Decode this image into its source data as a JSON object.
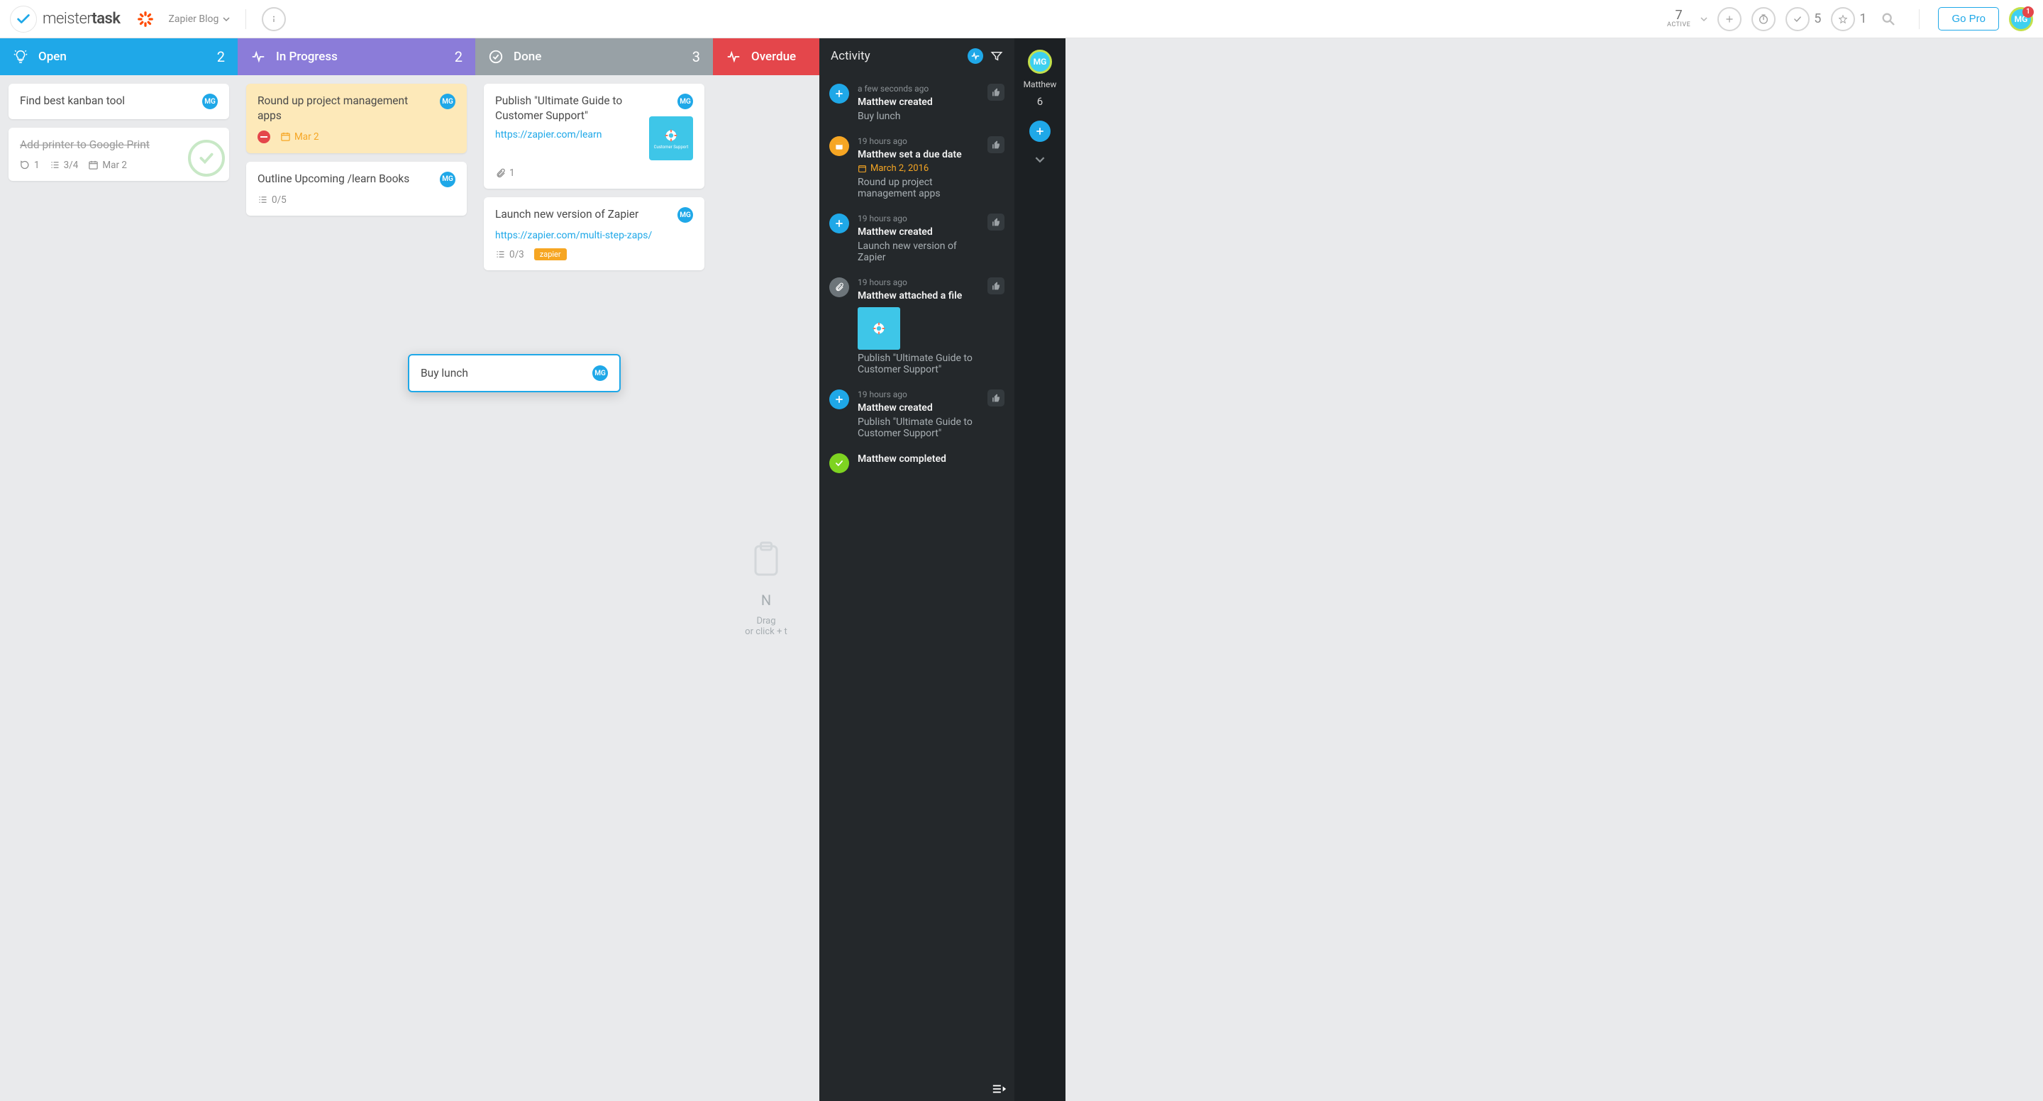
{
  "header": {
    "logo_light": "meister",
    "logo_bold": "task",
    "project_name": "Zapier Blog",
    "active_count": "7",
    "active_label": "ACTIVE",
    "check_count": "5",
    "star_count": "1",
    "go_pro": "Go Pro",
    "avatar_initials": "MG",
    "avatar_badge": "1"
  },
  "columns": {
    "open": {
      "title": "Open",
      "count": "2"
    },
    "progress": {
      "title": "In Progress",
      "count": "2"
    },
    "done": {
      "title": "Done",
      "count": "3"
    },
    "overdue": {
      "title": "Overdue"
    }
  },
  "cards": {
    "open1": {
      "title": "Find best kanban tool",
      "avatar": "MG"
    },
    "open2": {
      "title": "Add printer to Google Print",
      "comments": "1",
      "checklist": "3/4",
      "date": "Mar 2"
    },
    "prog1": {
      "title": "Round up project management apps",
      "avatar": "MG",
      "date": "Mar 2"
    },
    "prog2": {
      "title": "Outline Upcoming /learn Books",
      "avatar": "MG",
      "checklist": "0/5"
    },
    "done1": {
      "title": "Publish \"Ultimate Guide to Customer Support\"",
      "avatar": "MG",
      "link": "https://zapier.com/learn",
      "attach": "1"
    },
    "done2": {
      "title": "Launch new version of Zapier",
      "avatar": "MG",
      "link": "https://zapier.com/multi-step-zaps/",
      "checklist": "0/3",
      "tag": "zapier"
    }
  },
  "floating": {
    "title": "Buy lunch",
    "avatar": "MG"
  },
  "overdue_empty": {
    "title_visible": "N",
    "line1": "Drag",
    "line2": "or click + t"
  },
  "activity": {
    "title": "Activity",
    "items": [
      {
        "icon": "plus",
        "time": "a few seconds ago",
        "title": "Matthew created",
        "sub": "Buy lunch"
      },
      {
        "icon": "calendar",
        "time": "19 hours ago",
        "title": "Matthew set a due date",
        "date": "March 2, 2016",
        "sub": "Round up project management apps"
      },
      {
        "icon": "plus",
        "time": "19 hours ago",
        "title": "Matthew created",
        "sub": "Launch new version of Zapier"
      },
      {
        "icon": "clip",
        "time": "19 hours ago",
        "title": "Matthew attached a file",
        "thumb": true,
        "sub": "Publish \"Ultimate Guide to Customer Support\""
      },
      {
        "icon": "plus",
        "time": "19 hours ago",
        "title": "Matthew created",
        "sub": "Publish \"Ultimate Guide to Customer Support\""
      },
      {
        "icon": "check",
        "time": "",
        "title": "Matthew completed",
        "sub": ""
      }
    ]
  },
  "rail": {
    "avatar": "MG",
    "name": "Matthew",
    "count": "6"
  }
}
